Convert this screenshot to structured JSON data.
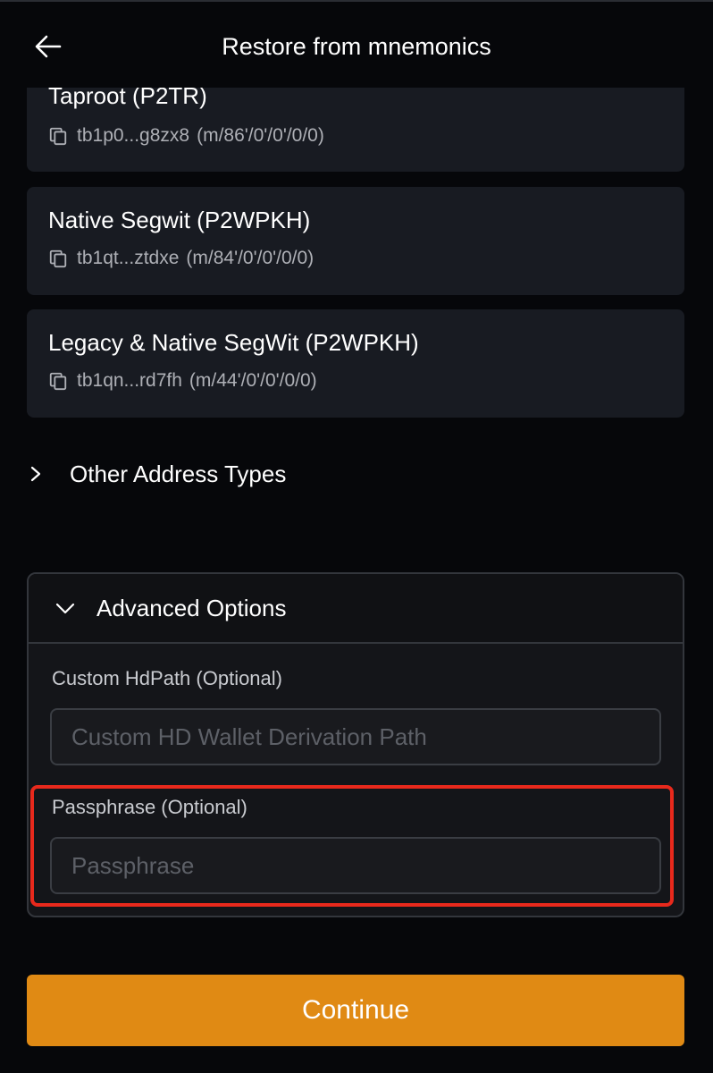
{
  "header": {
    "title": "Restore from mnemonics"
  },
  "address_types": [
    {
      "name": "Taproot (P2TR)",
      "address": "tb1p0...g8zx8",
      "path": "(m/86'/0'/0'/0/0)"
    },
    {
      "name": "Native Segwit (P2WPKH)",
      "address": "tb1qt...ztdxe",
      "path": "(m/84'/0'/0'/0/0)"
    },
    {
      "name": "Legacy & Native SegWit (P2WPKH)",
      "address": "tb1qn...rd7fh",
      "path": "(m/44'/0'/0'/0/0)"
    }
  ],
  "other_types": {
    "label": "Other Address Types"
  },
  "advanced": {
    "title": "Advanced Options",
    "hdpath_label": "Custom HdPath (Optional)",
    "hdpath_placeholder": "Custom HD Wallet Derivation Path",
    "hdpath_value": "",
    "passphrase_label": "Passphrase (Optional)",
    "passphrase_placeholder": "Passphrase",
    "passphrase_value": ""
  },
  "footer": {
    "continue_label": "Continue"
  },
  "icons": {
    "back": "arrow-left-icon",
    "copy": "copy-icon",
    "collapsed": "chevron-right-icon",
    "expanded": "chevron-down-icon"
  },
  "colors": {
    "accent": "#e08a14",
    "highlight": "#e8291c",
    "card": "#181b22"
  }
}
